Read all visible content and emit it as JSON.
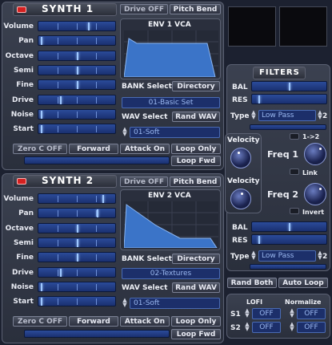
{
  "accent_blue": "#2b4b9a",
  "led_red": "#d42020",
  "synth1": {
    "title": "SYNTH 1",
    "drive_btn": "Drive OFF",
    "pitch_btn": "Pitch Bend",
    "rows": [
      {
        "label": "Volume",
        "value": 0.65
      },
      {
        "label": "Pan",
        "value": 0.0
      },
      {
        "label": "Octave",
        "value": 0.5
      },
      {
        "label": "Semi",
        "value": 0.5
      },
      {
        "label": "Fine",
        "value": 0.5
      },
      {
        "label": "Drive",
        "value": 0.27
      },
      {
        "label": "Noise",
        "value": 0.0
      },
      {
        "label": "Start",
        "value": 0.0
      }
    ],
    "env_title": "ENV 1 VCA",
    "bank_label": "BANK Select",
    "directory_btn": "Directory",
    "bank_value": "01-Basic Set",
    "wav_label": "WAV Select",
    "rand_wav_btn": "Rand WAV",
    "wav_value": "01-Soft",
    "zero_c_btn": "Zero C OFF",
    "forward_btn": "Forward",
    "attack_btn": "Attack On",
    "loop_only_btn": "Loop Only",
    "loop_fwd_btn": "Loop Fwd"
  },
  "synth2": {
    "title": "SYNTH 2",
    "drive_btn": "Drive OFF",
    "pitch_btn": "Pitch Bend",
    "rows": [
      {
        "label": "Volume",
        "value": 0.85
      },
      {
        "label": "Pan",
        "value": 0.78
      },
      {
        "label": "Octave",
        "value": 0.5
      },
      {
        "label": "Semi",
        "value": 0.5
      },
      {
        "label": "Fine",
        "value": 0.5
      },
      {
        "label": "Drive",
        "value": 0.27
      },
      {
        "label": "Noise",
        "value": 0.0
      },
      {
        "label": "Start",
        "value": 0.0
      }
    ],
    "env_title": "ENV 2 VCA",
    "bank_label": "BANK Select",
    "directory_btn": "Directory",
    "bank_value": "02-Textures",
    "wav_label": "WAV Select",
    "rand_wav_btn": "Rand WAV",
    "wav_value": "01-Soft",
    "zero_c_btn": "Zero C OFF",
    "forward_btn": "Forward",
    "attack_btn": "Attack On",
    "loop_only_btn": "Loop Only",
    "loop_fwd_btn": "Loop Fwd"
  },
  "filters": {
    "title": "FILTERS",
    "bal_label": "BAL",
    "res_label": "RES",
    "type_label": "Type",
    "type1_value": "Low Pass",
    "type1_num": "2",
    "route_label": "1->2",
    "link_label": "Link",
    "invert_label": "Invert",
    "type2_value": "Low Pass",
    "type2_num": "2"
  },
  "velocity1_label": "Velocity",
  "velocity2_label": "Velocity",
  "freq1_label": "Freq 1",
  "freq2_label": "Freq 2",
  "rand_both_btn": "Rand Both",
  "auto_loop_btn": "Auto Loop",
  "lofi": {
    "lofi_label": "LOFI",
    "normalize_label": "Normalize",
    "s1_label": "S1",
    "s2_label": "S2",
    "s1_lofi": "OFF",
    "s1_norm": "OFF",
    "s2_lofi": "OFF",
    "s2_norm": "OFF"
  }
}
